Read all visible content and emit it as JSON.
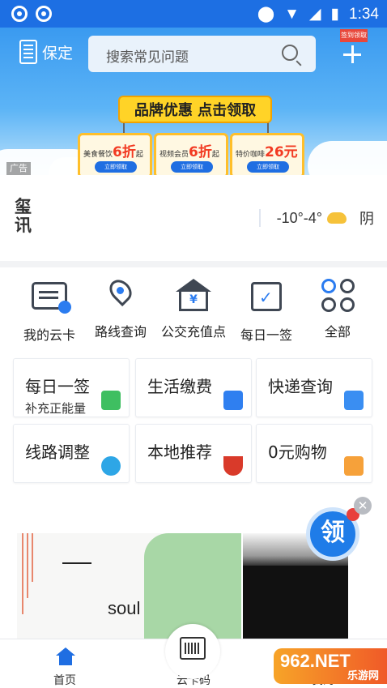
{
  "status_bar": {
    "time": "1:34"
  },
  "header": {
    "city": "保定",
    "search_placeholder": "搜索常见问题",
    "plus_tag": "签到领取"
  },
  "banner": {
    "headline": "品牌优惠 点击领取",
    "ad_label": "广告",
    "coupons": [
      {
        "name": "美食餐饮",
        "value": "6折",
        "suffix": "起",
        "button": "立即领取"
      },
      {
        "name": "视频会员",
        "value": "6折",
        "suffix": "起",
        "button": "立即领取"
      },
      {
        "name": "特价咖啡",
        "value": "26元",
        "suffix": "",
        "button": "立即领取"
      }
    ]
  },
  "infobar": {
    "news_icon": "玺讯",
    "temperature": "-10°-4°",
    "condition": "阴"
  },
  "quick_actions": [
    {
      "label": "我的云卡",
      "icon": "card-icon"
    },
    {
      "label": "路线查询",
      "icon": "location-pin-icon"
    },
    {
      "label": "公交充值点",
      "icon": "recharge-point-icon"
    },
    {
      "label": "每日一签",
      "icon": "calendar-check-icon"
    },
    {
      "label": "全部",
      "icon": "grid-circles-icon"
    }
  ],
  "tiles": [
    {
      "title": "每日一签",
      "subtitle": "补充正能量",
      "icon": "calendar-check-icon",
      "color": "#3fbf61"
    },
    {
      "title": "生活缴费",
      "subtitle": "",
      "icon": "play-icon",
      "color": "#2f7ff0"
    },
    {
      "title": "快递查询",
      "subtitle": "",
      "icon": "box-icon",
      "color": "#3a8ef2"
    },
    {
      "title": "线路调整",
      "subtitle": "",
      "icon": "route-pin-icon",
      "color": "#2ea6e6"
    },
    {
      "title": "本地推荐",
      "subtitle": "",
      "icon": "noodle-bowl-icon",
      "color": "#d93a2a"
    },
    {
      "title": "0元购物",
      "subtitle": "",
      "icon": "shopping-bag-icon",
      "color": "#f6a13a"
    }
  ],
  "floating": {
    "label": "领"
  },
  "feed": {
    "card_text": "soul"
  },
  "tabbar": {
    "home": "首页",
    "scan": "云卡码",
    "mine": "我的"
  },
  "watermark": {
    "main": "962.NET",
    "sub": "乐游网"
  },
  "colors": {
    "primary": "#1d6fe3",
    "accent_red": "#f23a22",
    "coupon_yellow": "#ffd327"
  }
}
